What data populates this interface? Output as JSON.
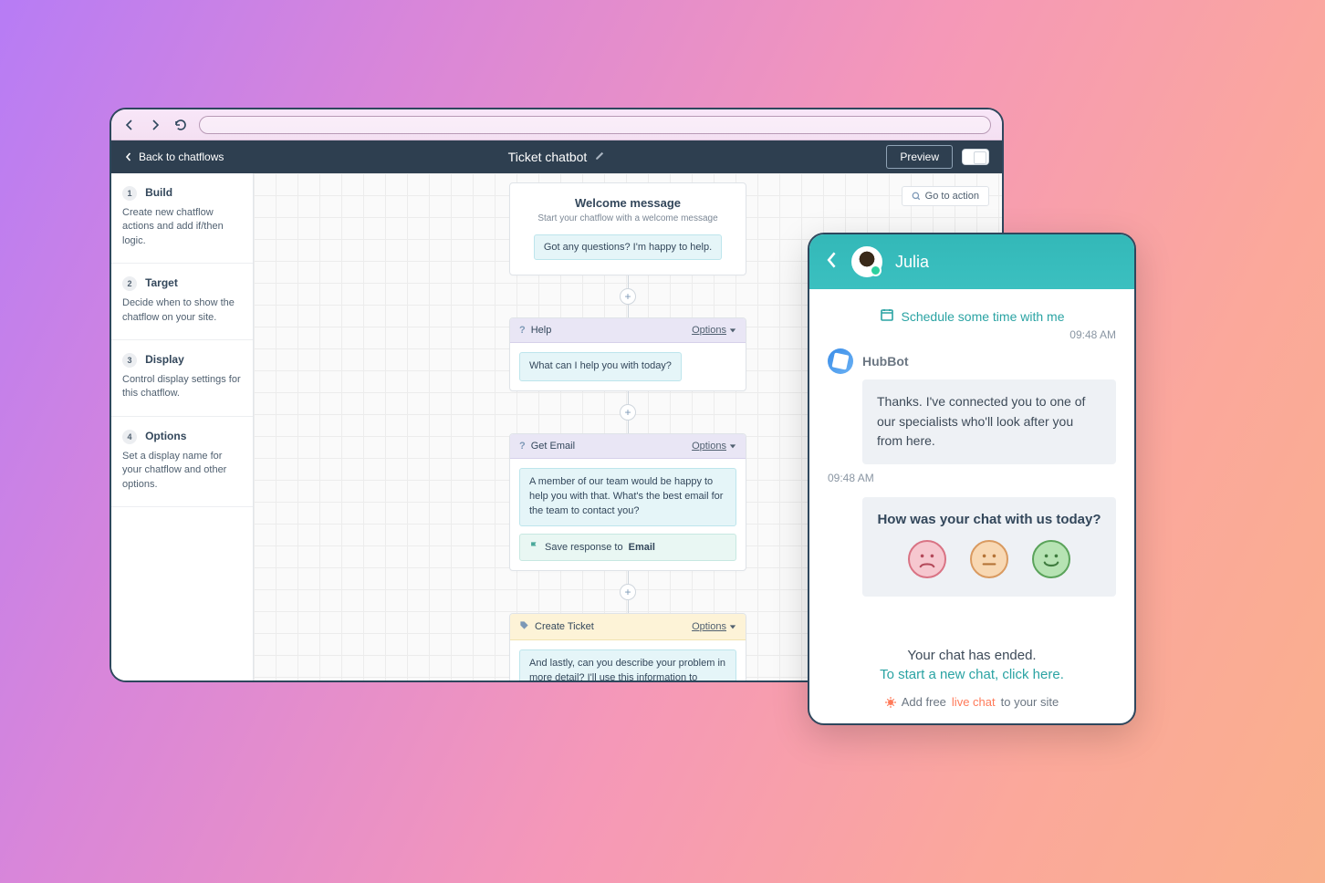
{
  "browser": {},
  "header": {
    "back": "Back to chatflows",
    "title": "Ticket chatbot",
    "preview": "Preview"
  },
  "goaction": "Go to action",
  "sidebar": {
    "steps": [
      {
        "name": "Build",
        "desc": "Create new chatflow actions and add if/then logic."
      },
      {
        "name": "Target",
        "desc": "Decide when to show the chatflow on your site."
      },
      {
        "name": "Display",
        "desc": "Control display settings for this chatflow."
      },
      {
        "name": "Options",
        "desc": "Set a display name for your chatflow and other options."
      }
    ]
  },
  "flow": {
    "welcome": {
      "title": "Welcome message",
      "sub": "Start your chatflow with a welcome message",
      "msg": "Got any questions? I'm happy to help."
    },
    "help": {
      "title": "Help",
      "msg": "What can I help you with today?",
      "options": "Options"
    },
    "email": {
      "title": "Get Email",
      "msg": "A member of our team would be happy to help you with that. What's the best email for the team to contact you?",
      "save_prefix": "Save response to ",
      "save_field": "Email",
      "options": "Options"
    },
    "ticket": {
      "title": "Create Ticket",
      "msg": "And lastly, can you describe your problem in more detail? I'll use this information to submit a ticket to our team.",
      "options": "Options"
    }
  },
  "chat": {
    "agent": "Julia",
    "schedule": "Schedule some time with me",
    "ts1": "09:48 AM",
    "sender": "HubBot",
    "message": "Thanks. I've connected you to one of our specialists who'll look after you from here.",
    "ts2": "09:48 AM",
    "rating_q": "How was your chat with us today?",
    "ended": "Your chat has ended.",
    "startnew": "To start a new chat, click here.",
    "addfree_pre": "Add free ",
    "addfree_link": "live chat",
    "addfree_post": " to your site"
  }
}
